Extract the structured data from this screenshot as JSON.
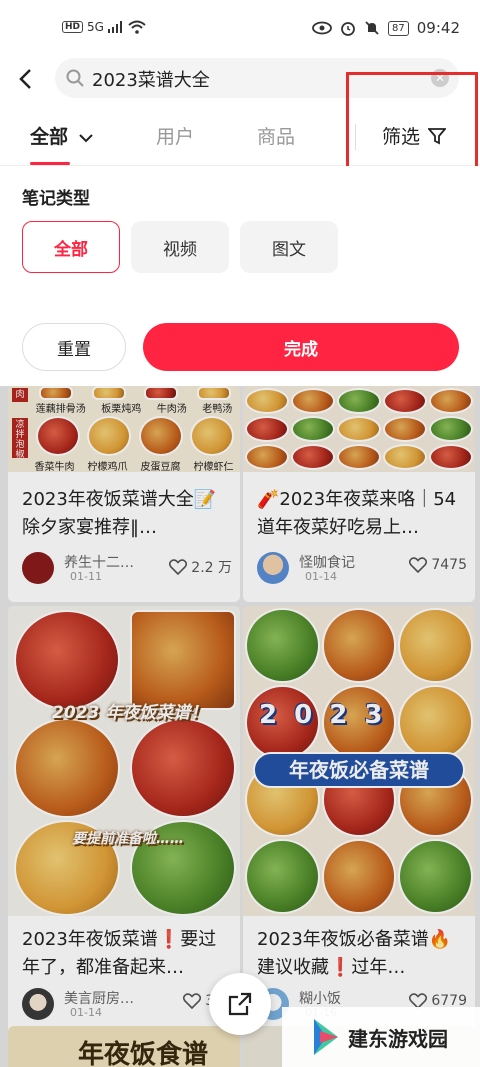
{
  "status_bar": {
    "hd": "HD",
    "network": "5G",
    "battery": "87",
    "time": "09:42"
  },
  "search": {
    "query": "2023菜谱大全",
    "clear_icon": "clear-icon"
  },
  "tabs": [
    {
      "label": "全部",
      "active": true
    },
    {
      "label": "用户",
      "active": false
    },
    {
      "label": "商品",
      "active": false
    }
  ],
  "filter": {
    "label": "筛选"
  },
  "panel": {
    "title": "笔记类型",
    "chips": [
      {
        "label": "全部",
        "active": true
      },
      {
        "label": "视频",
        "active": false
      },
      {
        "label": "图文",
        "active": false
      }
    ],
    "reset_label": "重置",
    "done_label": "完成"
  },
  "feed": [
    {
      "title": "2023年夜饭菜谱大全📝除夕家宴推荐‖…",
      "author": "养生十二…",
      "date": "01-11",
      "likes": "2.2 万",
      "image_labels": [
        "莲藕排骨汤",
        "板栗炖鸡",
        "牛肉汤",
        "老鸭汤",
        "凉拌泡椒",
        "香菜牛肉",
        "柠檬鸡爪",
        "皮蛋豆腐",
        "柠檬虾仁"
      ]
    },
    {
      "title": "🧨2023年夜菜来咯｜54道年夜菜好吃易上…",
      "author": "怪咖食记",
      "date": "01-14",
      "likes": "7475"
    },
    {
      "title": "2023年夜饭菜谱❗要过年了，都准备起来…",
      "author": "美言厨房…",
      "date": "01-14",
      "likes": "336",
      "image_labels": [
        "2023 年夜饭菜谱！",
        "要提前准备啦……"
      ]
    },
    {
      "title": "2023年夜饭必备菜谱🔥建议收藏❗过年…",
      "author": "糊小饭",
      "date": "01-16",
      "likes": "6779",
      "image_labels": [
        "2 0 2 3",
        "年夜饭必备菜谱"
      ]
    }
  ],
  "bottom_peek": "年夜饭食谱",
  "watermark": "建东游戏园"
}
